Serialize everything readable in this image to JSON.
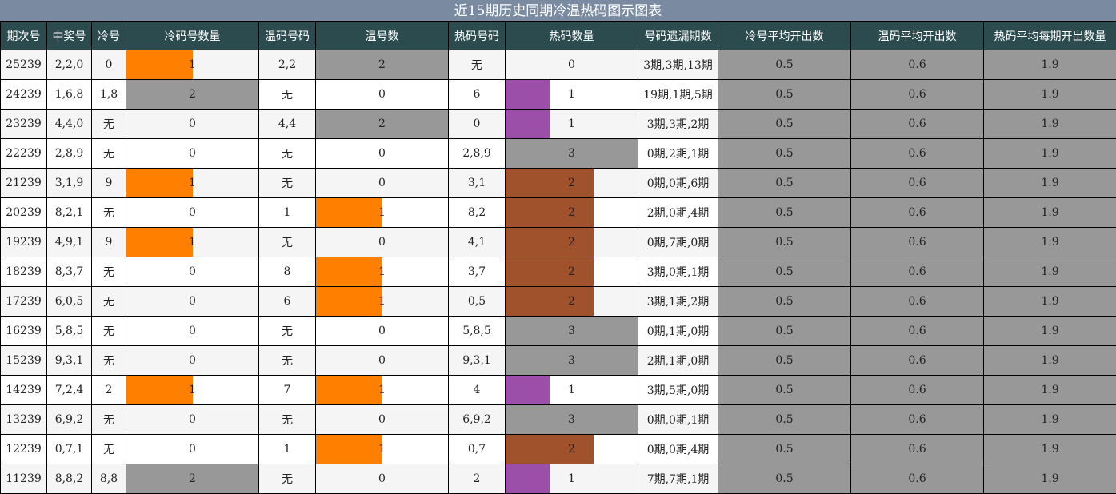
{
  "title": "近15期历史同期冷温热码图示图表",
  "headers": [
    "期次号",
    "中奖号",
    "冷号",
    "冷码号数量",
    "温码号码",
    "温号数",
    "热码号码",
    "热码数量",
    "号码遗漏期数",
    "冷号平均开出数",
    "温码平均开出数",
    "热码平均每期开出数量"
  ],
  "colors": {
    "title_bg": "#7a8ba1",
    "header_bg": "#2c4b4f",
    "gray": "#989898",
    "orange": "#ff8000",
    "purple": "#9b4fa8",
    "brown": "#a0522d"
  },
  "chart_data": {
    "type": "table",
    "title": "近15期历史同期冷温热码图示图表",
    "columns": [
      "期次号",
      "中奖号",
      "冷号",
      "冷码号数量",
      "温码号码",
      "温号数",
      "热码号码",
      "热码数量",
      "号码遗漏期数",
      "冷号平均开出数",
      "温码平均开出数",
      "热码平均每期开出数量"
    ],
    "rows": [
      {
        "period": "25239",
        "winning": "2,2,0",
        "cold": "0",
        "cold_count": 1,
        "warm": "2,2",
        "warm_count": 2,
        "hot": "无",
        "hot_count": 0,
        "missing": "3期,3期,13期",
        "cold_avg": "0.5",
        "warm_avg": "0.6",
        "hot_avg": "1.9"
      },
      {
        "period": "24239",
        "winning": "1,6,8",
        "cold": "1,8",
        "cold_count": 2,
        "warm": "无",
        "warm_count": 0,
        "hot": "6",
        "hot_count": 1,
        "missing": "19期,1期,5期",
        "cold_avg": "0.5",
        "warm_avg": "0.6",
        "hot_avg": "1.9"
      },
      {
        "period": "23239",
        "winning": "4,4,0",
        "cold": "无",
        "cold_count": 0,
        "warm": "4,4",
        "warm_count": 2,
        "hot": "0",
        "hot_count": 1,
        "missing": "3期,3期,2期",
        "cold_avg": "0.5",
        "warm_avg": "0.6",
        "hot_avg": "1.9"
      },
      {
        "period": "22239",
        "winning": "2,8,9",
        "cold": "无",
        "cold_count": 0,
        "warm": "无",
        "warm_count": 0,
        "hot": "2,8,9",
        "hot_count": 3,
        "missing": "0期,2期,1期",
        "cold_avg": "0.5",
        "warm_avg": "0.6",
        "hot_avg": "1.9"
      },
      {
        "period": "21239",
        "winning": "3,1,9",
        "cold": "9",
        "cold_count": 1,
        "warm": "无",
        "warm_count": 0,
        "hot": "3,1",
        "hot_count": 2,
        "missing": "0期,0期,6期",
        "cold_avg": "0.5",
        "warm_avg": "0.6",
        "hot_avg": "1.9"
      },
      {
        "period": "20239",
        "winning": "8,2,1",
        "cold": "无",
        "cold_count": 0,
        "warm": "1",
        "warm_count": 1,
        "hot": "8,2",
        "hot_count": 2,
        "missing": "2期,0期,4期",
        "cold_avg": "0.5",
        "warm_avg": "0.6",
        "hot_avg": "1.9"
      },
      {
        "period": "19239",
        "winning": "4,9,1",
        "cold": "9",
        "cold_count": 1,
        "warm": "无",
        "warm_count": 0,
        "hot": "4,1",
        "hot_count": 2,
        "missing": "0期,7期,0期",
        "cold_avg": "0.5",
        "warm_avg": "0.6",
        "hot_avg": "1.9"
      },
      {
        "period": "18239",
        "winning": "8,3,7",
        "cold": "无",
        "cold_count": 0,
        "warm": "8",
        "warm_count": 1,
        "hot": "3,7",
        "hot_count": 2,
        "missing": "3期,0期,1期",
        "cold_avg": "0.5",
        "warm_avg": "0.6",
        "hot_avg": "1.9"
      },
      {
        "period": "17239",
        "winning": "6,0,5",
        "cold": "无",
        "cold_count": 0,
        "warm": "6",
        "warm_count": 1,
        "hot": "0,5",
        "hot_count": 2,
        "missing": "3期,1期,2期",
        "cold_avg": "0.5",
        "warm_avg": "0.6",
        "hot_avg": "1.9"
      },
      {
        "period": "16239",
        "winning": "5,8,5",
        "cold": "无",
        "cold_count": 0,
        "warm": "无",
        "warm_count": 0,
        "hot": "5,8,5",
        "hot_count": 3,
        "missing": "0期,1期,0期",
        "cold_avg": "0.5",
        "warm_avg": "0.6",
        "hot_avg": "1.9"
      },
      {
        "period": "15239",
        "winning": "9,3,1",
        "cold": "无",
        "cold_count": 0,
        "warm": "无",
        "warm_count": 0,
        "hot": "9,3,1",
        "hot_count": 3,
        "missing": "2期,1期,0期",
        "cold_avg": "0.5",
        "warm_avg": "0.6",
        "hot_avg": "1.9"
      },
      {
        "period": "14239",
        "winning": "7,2,4",
        "cold": "2",
        "cold_count": 1,
        "warm": "7",
        "warm_count": 1,
        "hot": "4",
        "hot_count": 1,
        "missing": "3期,5期,0期",
        "cold_avg": "0.5",
        "warm_avg": "0.6",
        "hot_avg": "1.9"
      },
      {
        "period": "13239",
        "winning": "6,9,2",
        "cold": "无",
        "cold_count": 0,
        "warm": "无",
        "warm_count": 0,
        "hot": "6,9,2",
        "hot_count": 3,
        "missing": "0期,0期,1期",
        "cold_avg": "0.5",
        "warm_avg": "0.6",
        "hot_avg": "1.9"
      },
      {
        "period": "12239",
        "winning": "0,7,1",
        "cold": "无",
        "cold_count": 0,
        "warm": "1",
        "warm_count": 1,
        "hot": "0,7",
        "hot_count": 2,
        "missing": "0期,0期,4期",
        "cold_avg": "0.5",
        "warm_avg": "0.6",
        "hot_avg": "1.9"
      },
      {
        "period": "11239",
        "winning": "8,8,2",
        "cold": "8,8",
        "cold_count": 2,
        "warm": "无",
        "warm_count": 0,
        "hot": "2",
        "hot_count": 1,
        "missing": "7期,7期,1期",
        "cold_avg": "0.5",
        "warm_avg": "0.6",
        "hot_avg": "1.9"
      }
    ]
  }
}
